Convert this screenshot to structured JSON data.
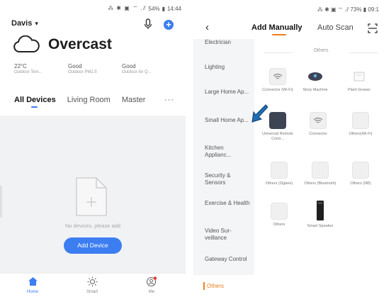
{
  "left": {
    "status": {
      "icons": "⁂ ✱ ▣ ⌔ .⫽",
      "battery": "54%",
      "time": "14:44"
    },
    "home_name": "Davis",
    "weather": {
      "condition": "Overcast"
    },
    "stats": [
      {
        "value": "22°C",
        "label": "Outdoor Tem..."
      },
      {
        "value": "Good",
        "label": "Outdoor PM2.5"
      },
      {
        "value": "Good",
        "label": "Outdoor Air Q..."
      }
    ],
    "tabs": [
      "All Devices",
      "Living Room",
      "Master"
    ],
    "tab_more": "···",
    "empty_text": "No devices, please add",
    "add_device": "Add Device",
    "nav": [
      {
        "label": "Home",
        "icon": "home-icon"
      },
      {
        "label": "Smart",
        "icon": "sun-icon"
      },
      {
        "label": "Me",
        "icon": "user-icon"
      }
    ]
  },
  "right": {
    "status": "⁂ ✱ ▣ ⌔ .⫽ 73% ▮ 09:1",
    "tabs": {
      "active": "Add Manually",
      "inactive": "Auto Scan"
    },
    "categories": [
      "Electrician",
      "Lighting",
      "Large Home Ap...",
      "Small Home Ap...",
      "Kitchen Applianc...",
      "Security & Sensors",
      "Exercise & Health",
      "Video Sur- veillance",
      "Gateway Control"
    ],
    "active_category": "Others",
    "section_title": "Others",
    "devices": [
      {
        "name": "Connector (Wi-Fi)",
        "icon": "wifi-icon"
      },
      {
        "name": "Story Machine",
        "icon": "story-machine-icon"
      },
      {
        "name": "Plant Grower",
        "icon": "plant-grower-icon"
      },
      {
        "name": "Universal Remote Contr...",
        "icon": "remote-icon"
      },
      {
        "name": "Connector",
        "icon": "wifi-icon"
      },
      {
        "name": "Others(Wi-Fi)",
        "icon": "generic-device-icon"
      },
      {
        "name": "Others (Zigbee)",
        "icon": "generic-device-icon"
      },
      {
        "name": "Others (Bluetooth)",
        "icon": "generic-device-icon"
      },
      {
        "name": "Others (NB)",
        "icon": "generic-device-icon"
      },
      {
        "name": "Others",
        "icon": "generic-device-icon"
      },
      {
        "name": "Smart Speaker",
        "icon": "speaker-icon"
      }
    ]
  },
  "colors": {
    "accent_blue": "#3c7ef2",
    "accent_orange": "#f07d1a",
    "pointer_arrow": "#1f6fb5"
  }
}
